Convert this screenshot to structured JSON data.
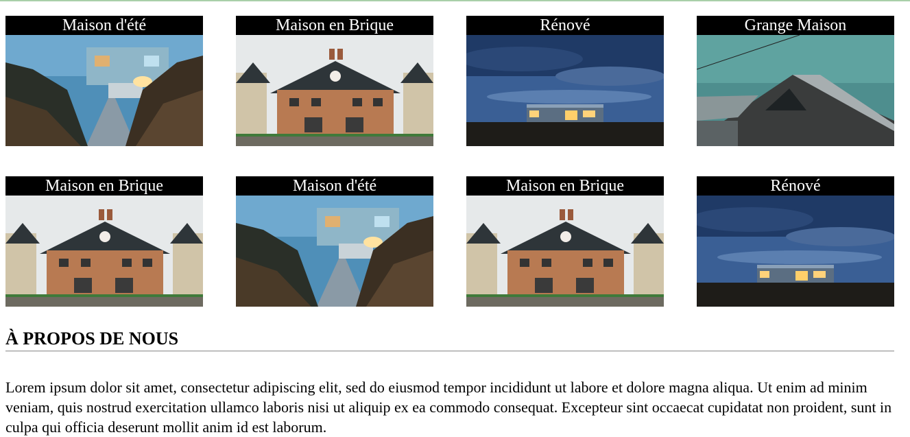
{
  "gallery": {
    "cards": [
      {
        "title": "Maison d'été",
        "photo": "summer-house-photo"
      },
      {
        "title": "Maison en Brique",
        "photo": "brick-house-photo"
      },
      {
        "title": "Rénové",
        "photo": "renovated-house-photo"
      },
      {
        "title": "Grange Maison",
        "photo": "barn-house-photo"
      },
      {
        "title": "Maison en Brique",
        "photo": "brick-house-photo"
      },
      {
        "title": "Maison d'été",
        "photo": "summer-house-photo"
      },
      {
        "title": "Maison en Brique",
        "photo": "brick-house-photo"
      },
      {
        "title": "Rénové",
        "photo": "renovated-house-photo"
      }
    ]
  },
  "about": {
    "heading": "À PROPOS DE NOUS",
    "paragraph": "Lorem ipsum dolor sit amet, consectetur adipiscing elit, sed do eiusmod tempor incididunt ut labore et dolore magna aliqua. Ut enim ad minim veniam, quis nostrud exercitation ullamco laboris nisi ut aliquip ex ea commodo consequat. Excepteur sint occaecat cupidatat non proident, sunt in culpa qui officia deserunt mollit anim id est laborum."
  }
}
